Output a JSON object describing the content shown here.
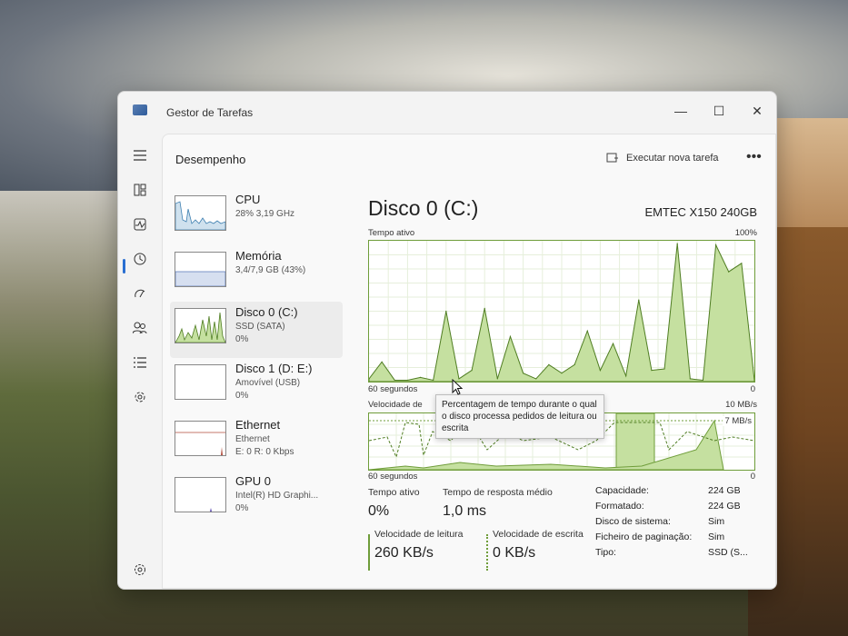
{
  "app": {
    "title": "Gestor de Tarefas",
    "minimize": "—",
    "maximize": "☐",
    "close": "✕"
  },
  "nav": {
    "icons": [
      "hamburger-icon",
      "processes-icon",
      "performance-icon",
      "app-history-icon",
      "startup-apps-icon",
      "users-icon",
      "details-icon",
      "services-icon",
      "settings-icon"
    ]
  },
  "header": {
    "page_title": "Desempenho",
    "run_task": "Executar nova tarefa",
    "more": "•••"
  },
  "devices": [
    {
      "name": "CPU",
      "sub": "28% 3,19 GHz",
      "val": ""
    },
    {
      "name": "Memória",
      "sub": "3,4/7,9 GB (43%)",
      "val": ""
    },
    {
      "name": "Disco 0 (C:)",
      "sub": "SSD (SATA)",
      "val": "0%"
    },
    {
      "name": "Disco 1 (D: E:)",
      "sub": "Amovível (USB)",
      "val": "0%"
    },
    {
      "name": "Ethernet",
      "sub": "Ethernet",
      "val": "E: 0 R: 0 Kbps"
    },
    {
      "name": "GPU 0",
      "sub": "Intel(R) HD Graphi...",
      "val": "0%"
    }
  ],
  "detail": {
    "title": "Disco 0 (C:)",
    "model": "EMTEC X150 240GB",
    "graph1": {
      "label_left": "Tempo ativo",
      "label_right": "100%",
      "bottom_left": "60 segundos",
      "bottom_right": "0"
    },
    "graph2": {
      "label_left": "Velocidade de",
      "label_right": "10 MB/s",
      "marker": "7 MB/s",
      "bottom_left": "60 segundos",
      "bottom_right": "0"
    },
    "tooltip": "Percentagem de tempo durante o qual o disco processa pedidos de leitura ou escrita",
    "stats": {
      "active_label": "Tempo ativo",
      "active_value": "0%",
      "response_label": "Tempo de resposta médio",
      "response_value": "1,0 ms",
      "read_label": "Velocidade de leitura",
      "read_value": "260 KB/s",
      "write_label": "Velocidade de escrita",
      "write_value": "0 KB/s"
    },
    "props": [
      {
        "k": "Capacidade:",
        "v": "224 GB"
      },
      {
        "k": "Formatado:",
        "v": "224 GB"
      },
      {
        "k": "Disco de sistema:",
        "v": "Sim"
      },
      {
        "k": "Ficheiro de paginação:",
        "v": "Sim"
      },
      {
        "k": "Tipo:",
        "v": "SSD (S..."
      }
    ]
  },
  "colors": {
    "accent": "#2a6fd1",
    "disk_green": "#6f9d3a",
    "disk_fill": "#c5e0a0"
  },
  "chart_data": {
    "type": "area",
    "title": "Tempo ativo",
    "ylim": [
      0,
      100
    ],
    "x": [
      60,
      58,
      56,
      54,
      52,
      50,
      48,
      46,
      44,
      42,
      40,
      38,
      36,
      34,
      32,
      30,
      28,
      26,
      24,
      22,
      20,
      18,
      16,
      14,
      12,
      10,
      8,
      6,
      4,
      2,
      0
    ],
    "series": [
      {
        "name": "Tempo ativo",
        "values": [
          2,
          14,
          1,
          1,
          3,
          1,
          50,
          2,
          8,
          52,
          2,
          32,
          6,
          2,
          12,
          6,
          12,
          36,
          8,
          27,
          4,
          58,
          8,
          9,
          98,
          2,
          1,
          97,
          78,
          84,
          1
        ]
      }
    ]
  }
}
